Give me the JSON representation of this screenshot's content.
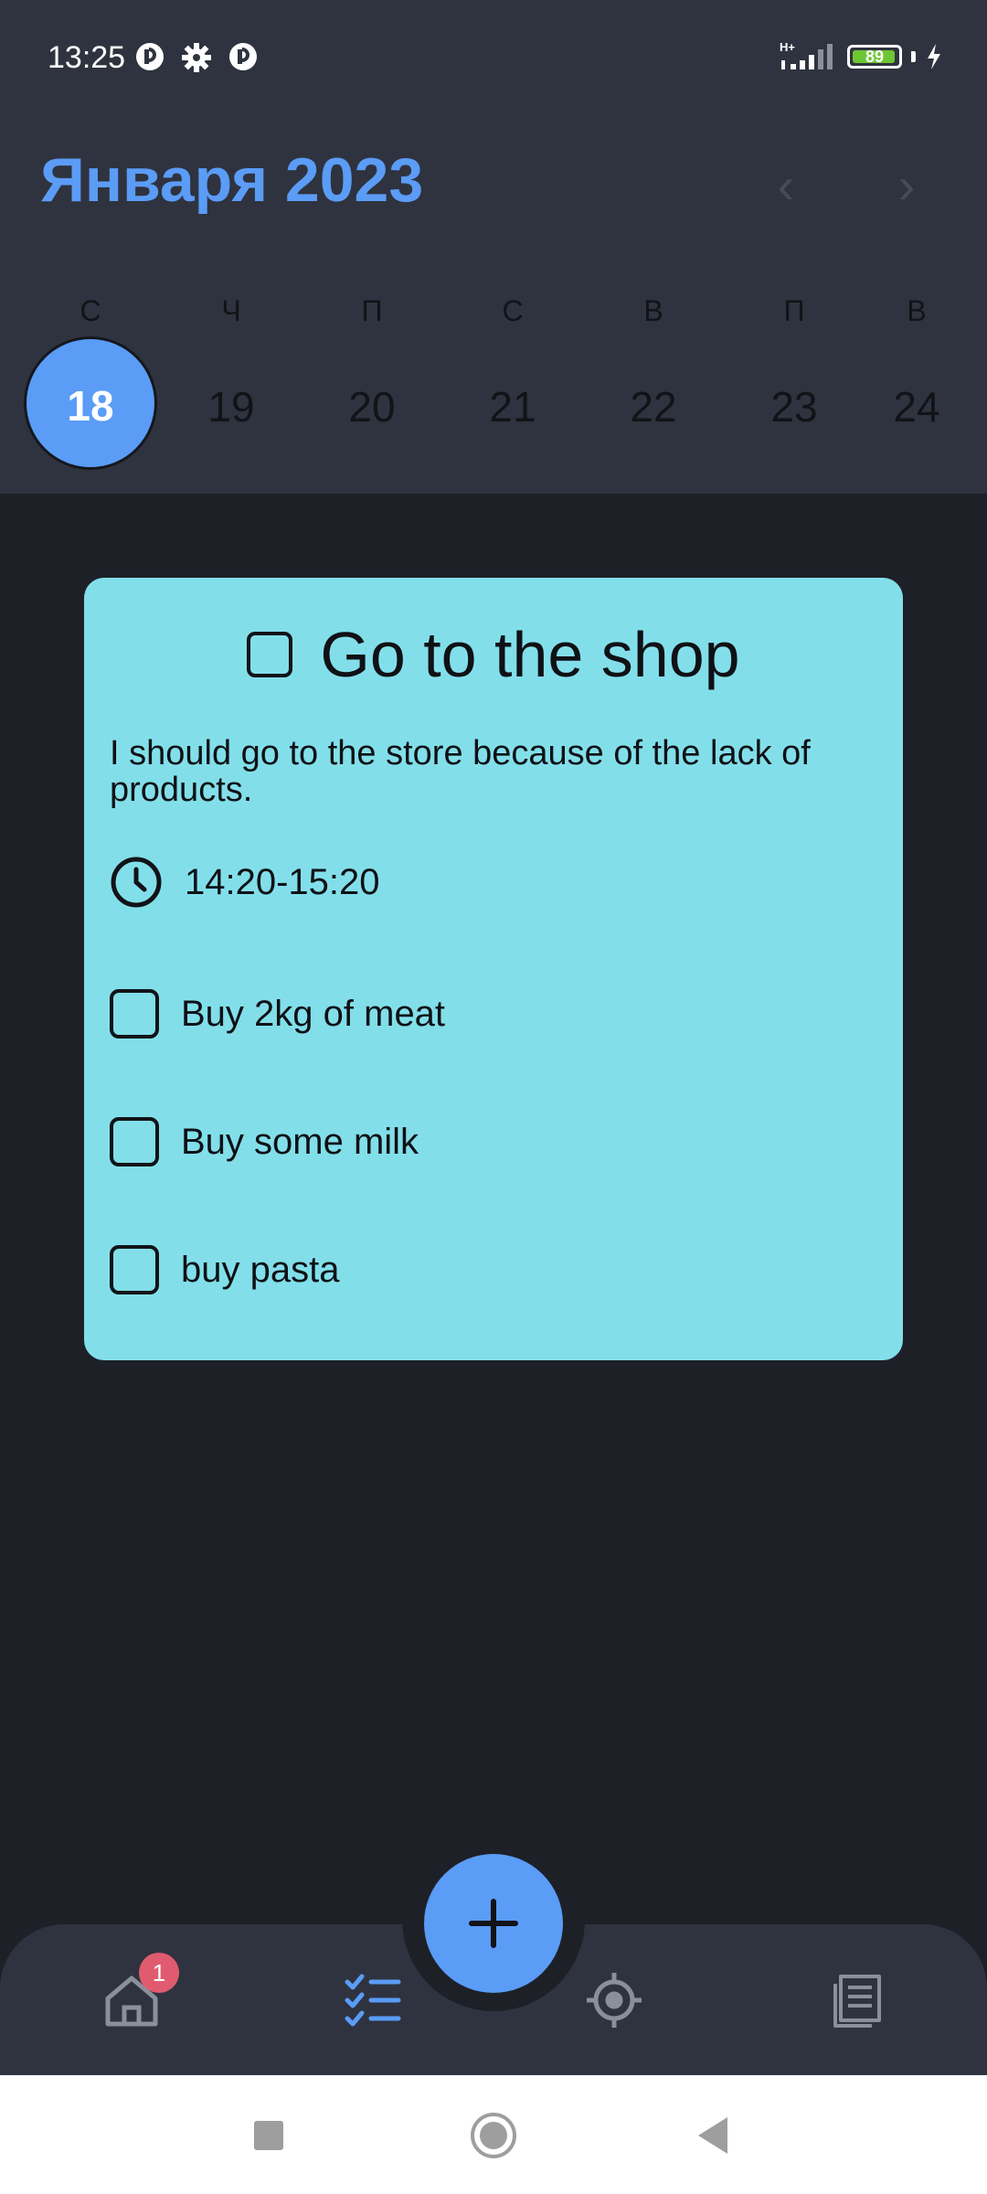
{
  "status_bar": {
    "time": "13:25",
    "network": "H+",
    "battery": 89
  },
  "calendar": {
    "month_title": "Января 2023",
    "prev_arrow": "‹",
    "next_arrow": "›",
    "weekdays": [
      "С",
      "Ч",
      "П",
      "С",
      "В",
      "П",
      "В"
    ],
    "days": [
      "18",
      "19",
      "20",
      "21",
      "22",
      "23",
      "24"
    ],
    "selected_day": "18"
  },
  "task": {
    "title": "Go to the shop",
    "description": "I should go to the store because of the lack of products.",
    "time": "14:20-15:20",
    "subtasks": [
      {
        "label": "Buy 2kg of meat",
        "checked": false
      },
      {
        "label": "Buy some milk",
        "checked": false
      },
      {
        "label": "buy pasta",
        "checked": false
      }
    ],
    "completed": false
  },
  "bottom_nav": {
    "home_badge": "1",
    "active": "tasks",
    "items": [
      "home-icon",
      "tasks-icon",
      "target-icon",
      "notes-icon"
    ]
  },
  "colors": {
    "accent": "#5a9cf6",
    "card": "#82dfea",
    "header": "#2f333f",
    "background": "#1e2028",
    "badge": "#e05b6f"
  }
}
